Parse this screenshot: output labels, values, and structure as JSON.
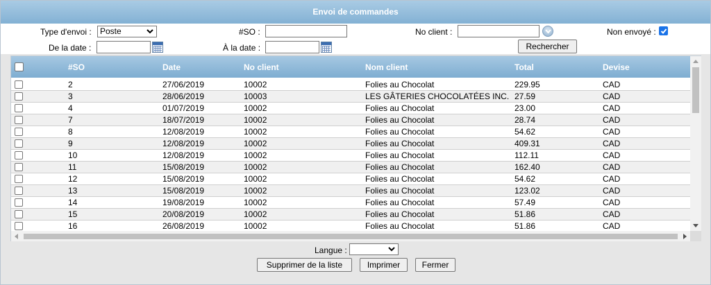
{
  "window": {
    "title": "Envoi de commandes"
  },
  "filters": {
    "type_envoi_label": "Type d'envoi :",
    "type_envoi_value": "Poste",
    "so_label": "#SO :",
    "so_value": "",
    "no_client_label": "No client :",
    "no_client_value": "",
    "non_envoye_label": "Non envoyé :",
    "non_envoye_checked": true,
    "de_la_date_label": "De la date :",
    "de_la_date_value": "",
    "a_la_date_label": "À la date :",
    "a_la_date_value": "",
    "search_label": "Rechercher"
  },
  "table": {
    "columns": [
      "#SO",
      "Date",
      "No client",
      "Nom client",
      "Total",
      "Devise"
    ],
    "rows": [
      [
        "2",
        "27/06/2019",
        "10002",
        "Folies au Chocolat",
        "229.95",
        "CAD"
      ],
      [
        "3",
        "28/06/2019",
        "10003",
        "LES GÂTERIES CHOCOLATÉES INC.",
        "27.59",
        "CAD"
      ],
      [
        "4",
        "01/07/2019",
        "10002",
        "Folies au Chocolat",
        "23.00",
        "CAD"
      ],
      [
        "7",
        "18/07/2019",
        "10002",
        "Folies au Chocolat",
        "28.74",
        "CAD"
      ],
      [
        "8",
        "12/08/2019",
        "10002",
        "Folies au Chocolat",
        "54.62",
        "CAD"
      ],
      [
        "9",
        "12/08/2019",
        "10002",
        "Folies au Chocolat",
        "409.31",
        "CAD"
      ],
      [
        "10",
        "12/08/2019",
        "10002",
        "Folies au Chocolat",
        "112.11",
        "CAD"
      ],
      [
        "11",
        "15/08/2019",
        "10002",
        "Folies au Chocolat",
        "162.40",
        "CAD"
      ],
      [
        "12",
        "15/08/2019",
        "10002",
        "Folies au Chocolat",
        "54.62",
        "CAD"
      ],
      [
        "13",
        "15/08/2019",
        "10002",
        "Folies au Chocolat",
        "123.02",
        "CAD"
      ],
      [
        "14",
        "19/08/2019",
        "10002",
        "Folies au Chocolat",
        "57.49",
        "CAD"
      ],
      [
        "15",
        "20/08/2019",
        "10002",
        "Folies au Chocolat",
        "51.86",
        "CAD"
      ],
      [
        "16",
        "26/08/2019",
        "10002",
        "Folies au Chocolat",
        "51.86",
        "CAD"
      ]
    ]
  },
  "footer": {
    "langue_label": "Langue :",
    "langue_value": "",
    "delete_label": "Supprimer de la liste",
    "print_label": "Imprimer",
    "close_label": "Fermer"
  },
  "colors": {
    "header_blue": "#83b1d4",
    "checkbox_blue": "#1a73e8"
  },
  "icons": [
    "calendar-icon",
    "lookup-icon",
    "chevron-down-icon"
  ]
}
